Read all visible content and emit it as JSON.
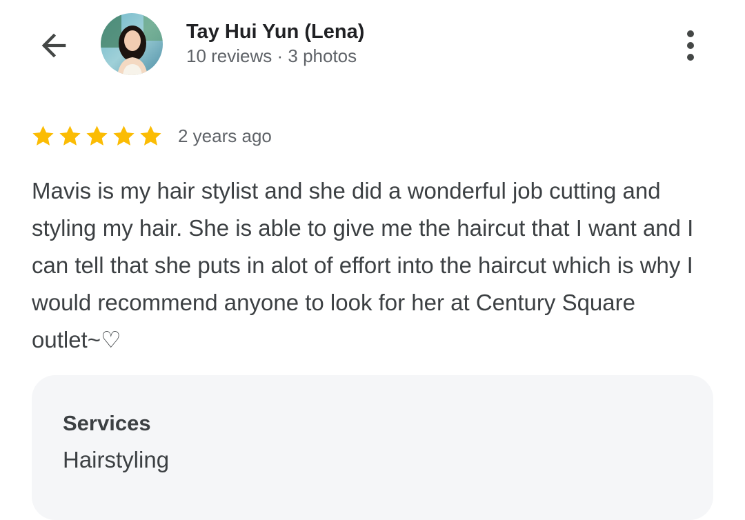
{
  "header": {
    "back_icon": "arrow-left-icon",
    "author_name": "Tay Hui Yun (Lena)",
    "author_meta": "10 reviews · 3 photos",
    "more_icon": "more-vertical-icon"
  },
  "review": {
    "rating": 5,
    "rating_max": 5,
    "star_color": "#fbbc04",
    "age": "2 years ago",
    "text": "Mavis is my hair stylist and she did a wonderful job cutting and styling my hair. She is able to give me the haircut that I want and I can tell that she puts in alot of effort into the haircut which is why I would recommend anyone to look for her at Century Square outlet~♡"
  },
  "services": {
    "title": "Services",
    "value": "Hairstyling"
  }
}
